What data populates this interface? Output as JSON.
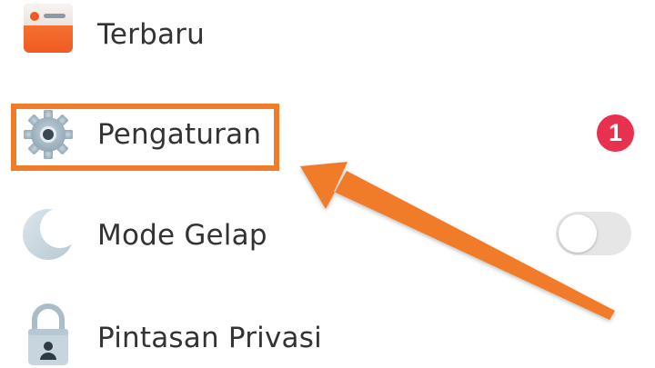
{
  "menu": {
    "items": [
      {
        "label": "Terbaru",
        "icon": "browser-window-icon"
      },
      {
        "label": "Pengaturan",
        "icon": "gear-icon",
        "badge": "1"
      },
      {
        "label": "Mode Gelap",
        "icon": "crescent-moon-icon",
        "toggle_on": false
      },
      {
        "label": "Pintasan Privasi",
        "icon": "padlock-icon"
      }
    ]
  },
  "annotation": {
    "highlight_color": "#f07c2a",
    "arrow_color": "#f07c2a"
  },
  "colors": {
    "badge": "#e8304f",
    "label_text": "#333333",
    "toggle_track": "#e6e6e6"
  }
}
